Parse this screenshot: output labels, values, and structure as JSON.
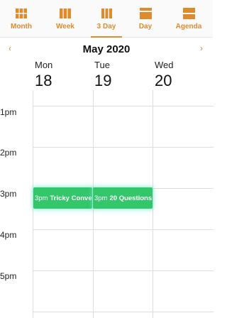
{
  "tabs": [
    {
      "label": "Month",
      "icon": "month-grid-icon"
    },
    {
      "label": "Week",
      "icon": "week-columns-icon"
    },
    {
      "label": "3 Day",
      "icon": "three-day-icon"
    },
    {
      "label": "Day",
      "icon": "day-rows-icon"
    },
    {
      "label": "Agenda",
      "icon": "agenda-list-icon"
    }
  ],
  "active_tab": "3 Day",
  "month_title": "May 2020",
  "prev_arrow": "‹",
  "next_arrow": "›",
  "days": [
    {
      "name": "Mon",
      "num": "18"
    },
    {
      "name": "Tue",
      "num": "19"
    },
    {
      "name": "Wed",
      "num": "20"
    }
  ],
  "times": [
    "1pm",
    "2pm",
    "3pm",
    "4pm",
    "5pm"
  ],
  "events": [
    {
      "time": "3pm",
      "title": "Tricky Conve"
    },
    {
      "time": "3pm",
      "title": "20 Questions"
    }
  ],
  "colors": {
    "accent": "#e08a2e",
    "event": "#33c66b"
  }
}
